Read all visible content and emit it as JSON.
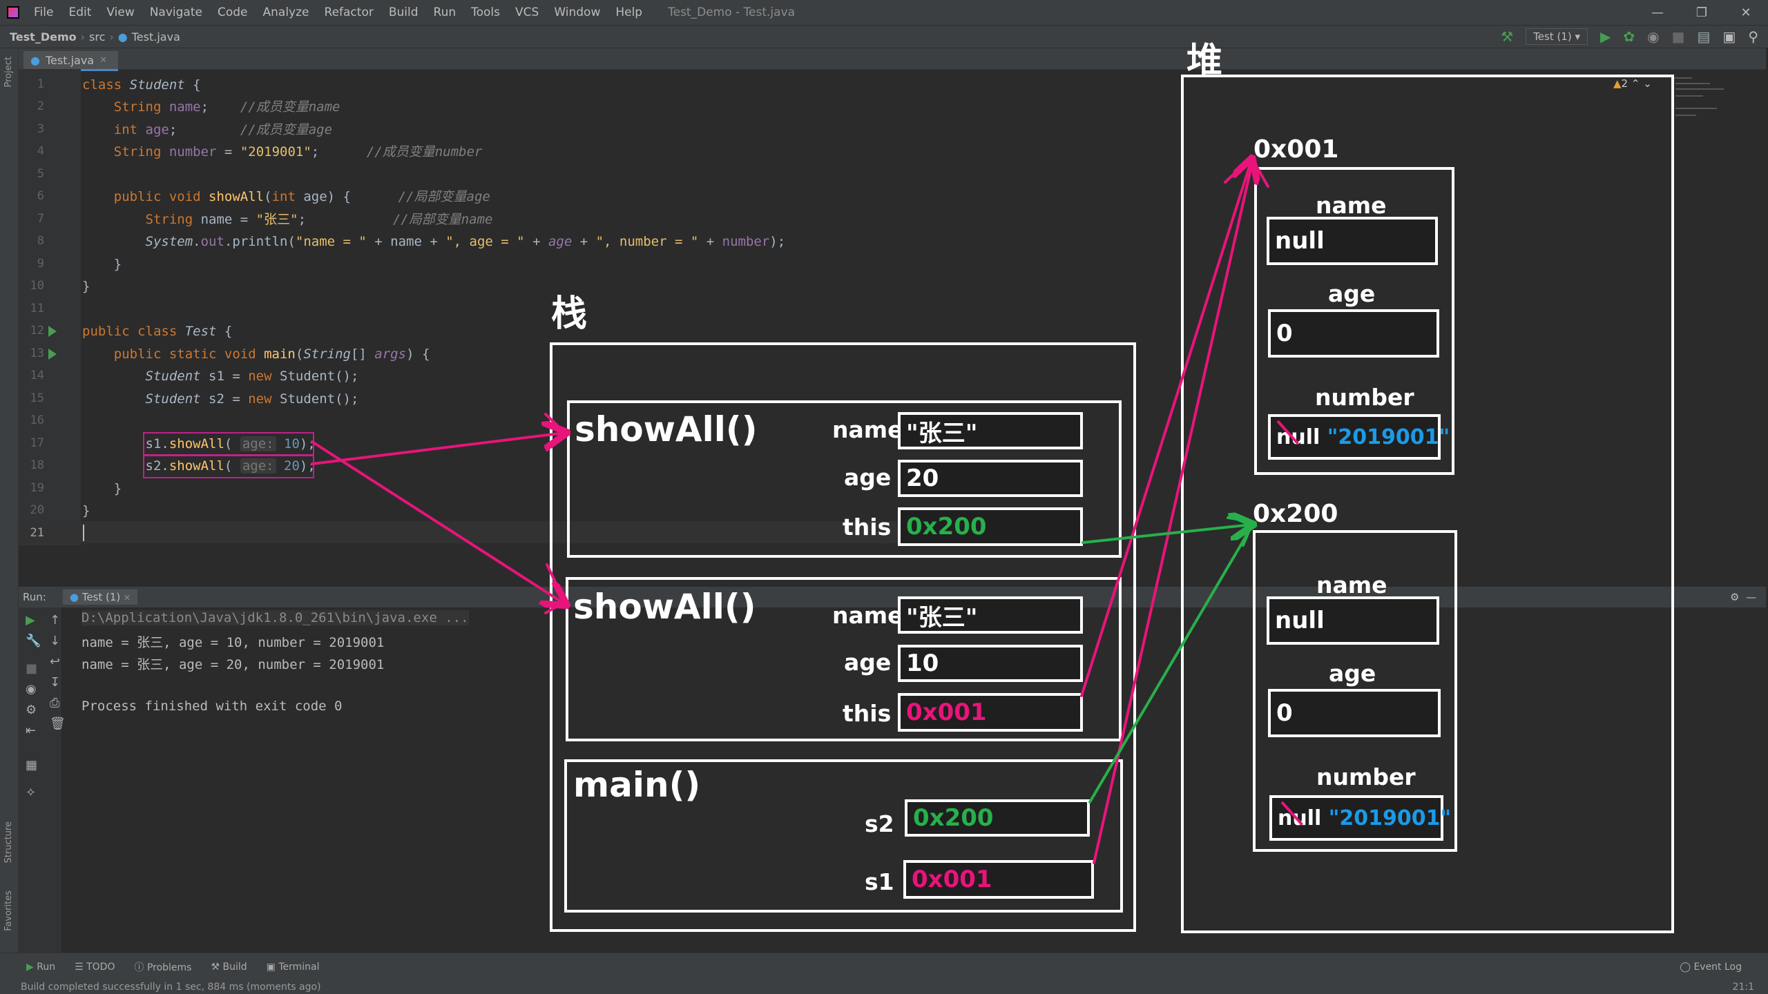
{
  "menubar": {
    "items": [
      "File",
      "Edit",
      "View",
      "Navigate",
      "Code",
      "Analyze",
      "Refactor",
      "Build",
      "Run",
      "Tools",
      "VCS",
      "Window",
      "Help"
    ],
    "title": "Test_Demo - Test.java"
  },
  "navbar": {
    "project": "Test_Demo",
    "src": "src",
    "file": "Test.java",
    "run_config": "Test (1)"
  },
  "tab": {
    "label": "Test.java"
  },
  "side_labels": {
    "project": "Project",
    "structure": "Structure",
    "favorites": "Favorites"
  },
  "editor": {
    "line_numbers": [
      "1",
      "2",
      "3",
      "4",
      "5",
      "6",
      "7",
      "8",
      "9",
      "10",
      "11",
      "12",
      "13",
      "14",
      "15",
      "16",
      "17",
      "18",
      "19",
      "20",
      "21"
    ],
    "inspection_count": "2",
    "hints": {
      "age": "age:",
      "v10": "10",
      "v20": "20"
    }
  },
  "run": {
    "label": "Run:",
    "tab": "Test (1)",
    "output": [
      "D:\\Application\\Java\\jdk1.8.0_261\\bin\\java.exe ...",
      "name = 张三, age = 10, number = 2019001",
      "name = 张三, age = 20, number = 2019001",
      "",
      "Process finished with exit code 0"
    ]
  },
  "bottom_tabs": [
    "Run",
    "TODO",
    "Problems",
    "Build",
    "Terminal"
  ],
  "event_log": "Event Log",
  "status": {
    "message": "Build completed successfully in 1 sec, 884 ms (moments ago)",
    "position": "21:1"
  },
  "diagram": {
    "stack_title": "栈",
    "heap_title": "堆",
    "frames": [
      {
        "method": "showAll()",
        "name_label": "name",
        "name_value": "\"张三\"",
        "age_label": "age",
        "age_value": "20",
        "this_label": "this",
        "this_value": "0x200"
      },
      {
        "method": "showAll()",
        "name_label": "name",
        "name_value": "\"张三\"",
        "age_label": "age",
        "age_value": "10",
        "this_label": "this",
        "this_value": "0x001"
      }
    ],
    "main": {
      "method": "main()",
      "s2_label": "s2",
      "s2_value": "0x200",
      "s1_label": "s1",
      "s1_value": "0x001"
    },
    "objects": [
      {
        "address": "0x001",
        "name_label": "name",
        "name_value": "null",
        "age_label": "age",
        "age_value": "0",
        "number_label": "number",
        "number_old": "null",
        "number_value": "\"2019001\""
      },
      {
        "address": "0x200",
        "name_label": "name",
        "name_value": "null",
        "age_label": "age",
        "age_value": "0",
        "number_label": "number",
        "number_old": "null",
        "number_value": "\"2019001\""
      }
    ],
    "colors": {
      "arrow_pink": "#e8147a",
      "arrow_green": "#27b04b",
      "value_blue": "#1a9be8",
      "box_white": "#ffffff"
    }
  }
}
